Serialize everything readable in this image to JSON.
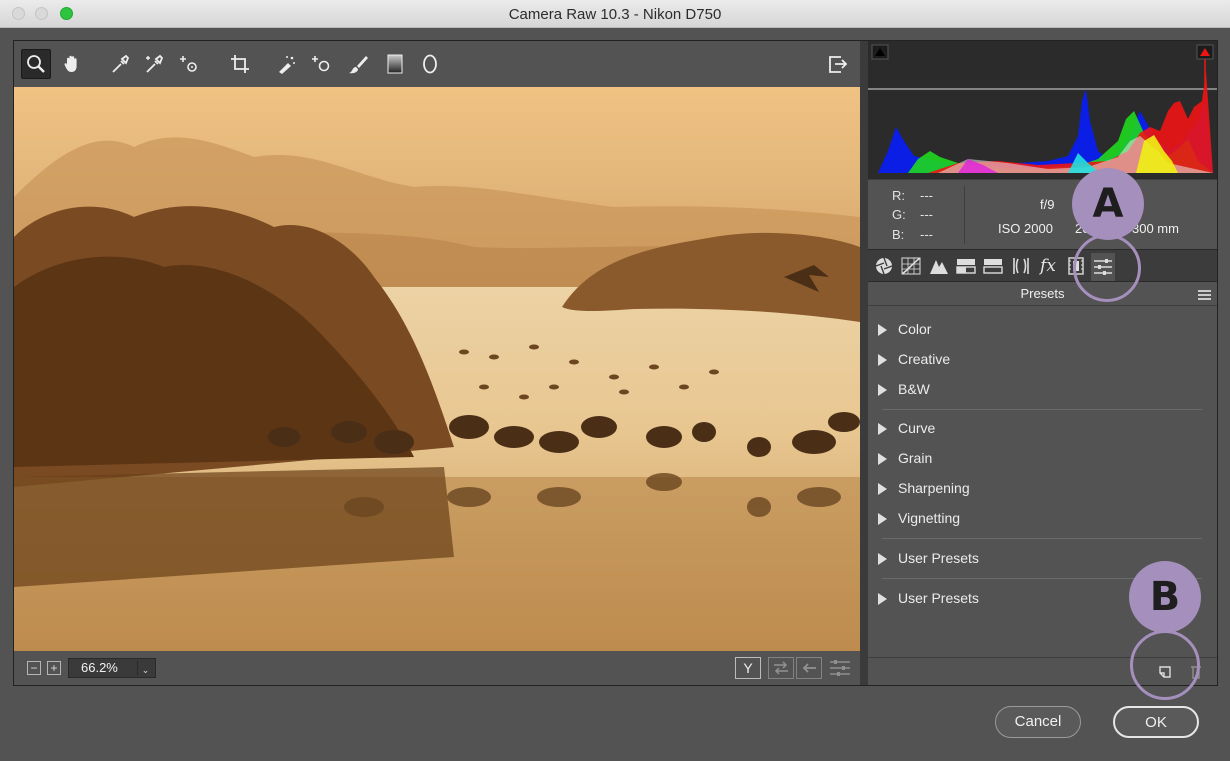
{
  "window": {
    "title": "Camera Raw 10.3  -  Nikon D750"
  },
  "toolbar": {
    "tools": [
      {
        "icon": "zoom-icon"
      },
      {
        "icon": "hand-icon"
      },
      {
        "icon": "white-balance-icon"
      },
      {
        "icon": "color-sampler-icon"
      },
      {
        "icon": "targeted-adjustment-icon"
      },
      {
        "icon": "crop-icon"
      },
      {
        "icon": "spot-removal-icon"
      },
      {
        "icon": "red-eye-icon"
      },
      {
        "icon": "adjustment-brush-icon"
      },
      {
        "icon": "graduated-filter-icon"
      },
      {
        "icon": "radial-filter-icon"
      },
      {
        "icon": "open-preferences-icon"
      }
    ]
  },
  "status": {
    "zoom_minus": "−",
    "zoom_plus": "+",
    "zoom_value": "66.2%",
    "zoom_arrow": "⌄",
    "view_icon": "Y"
  },
  "info": {
    "r_label": "R:",
    "r_value": "---",
    "g_label": "G:",
    "g_value": "---",
    "b_label": "B:",
    "b_value": "---",
    "aperture": "f/9",
    "iso": "ISO 2000",
    "focal_prefix": "20",
    "focal_suffix": "300 mm"
  },
  "tabs": [
    {
      "icon": "basic-aperture-icon"
    },
    {
      "icon": "tone-curve-icon"
    },
    {
      "icon": "detail-icon"
    },
    {
      "icon": "hsl-icon"
    },
    {
      "icon": "split-toning-icon"
    },
    {
      "icon": "lens-corrections-icon"
    },
    {
      "icon": "effects-fx-icon",
      "label": "fx"
    },
    {
      "icon": "camera-calibration-icon"
    },
    {
      "icon": "presets-icon"
    }
  ],
  "presets": {
    "header": "Presets",
    "groups": [
      {
        "label": "Color"
      },
      {
        "label": "Creative"
      },
      {
        "label": "B&W"
      },
      {
        "label": "Curve"
      },
      {
        "label": "Grain"
      },
      {
        "label": "Sharpening"
      },
      {
        "label": "Vignetting"
      },
      {
        "label": "User Presets"
      },
      {
        "label": "User Presets"
      }
    ]
  },
  "callouts": {
    "a": "A",
    "b": "B",
    "color": "#a58fbc"
  },
  "buttons": {
    "cancel": "Cancel",
    "ok": "OK"
  }
}
